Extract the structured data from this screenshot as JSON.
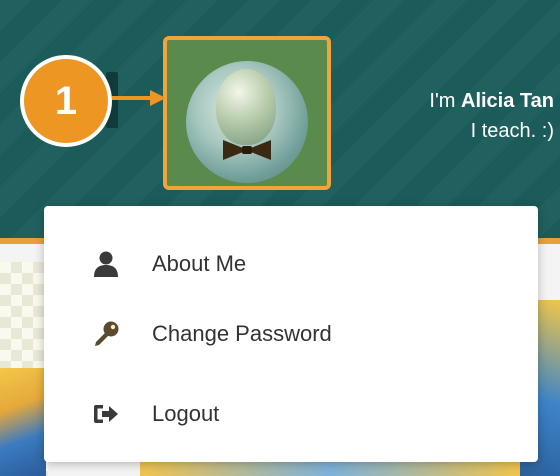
{
  "callout": {
    "number": "1"
  },
  "greeting": {
    "prefix": "I'm ",
    "name": "Alicia Tan",
    "tagline": "I teach. :)"
  },
  "menu": {
    "items": [
      {
        "label": "About Me",
        "icon": "user-icon"
      },
      {
        "label": "Change Password",
        "icon": "key-icon",
        "highlighted": true
      },
      {
        "label": "Logout",
        "icon": "sign-out-icon"
      }
    ]
  },
  "colors": {
    "header": "#1c5e5c",
    "accent": "#f2a33a",
    "highlight_fill": "#fdedc0",
    "icon": "#3a3a3a"
  }
}
